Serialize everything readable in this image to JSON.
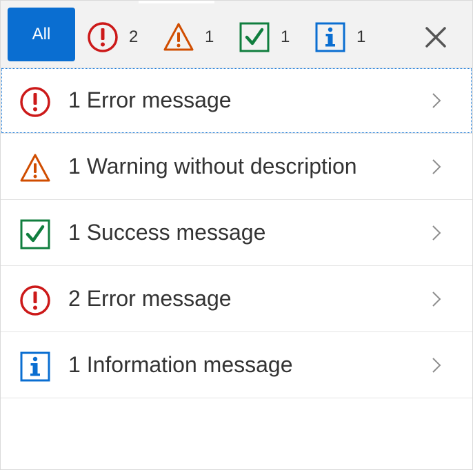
{
  "filter_bar": {
    "all_label": "All",
    "filters": [
      {
        "type": "error",
        "icon": "error-icon",
        "count": "2"
      },
      {
        "type": "warning",
        "icon": "warning-icon",
        "count": "1"
      },
      {
        "type": "success",
        "icon": "success-icon",
        "count": "1"
      },
      {
        "type": "information",
        "icon": "info-icon",
        "count": "1"
      }
    ],
    "close_icon": "close-icon"
  },
  "messages": [
    {
      "type": "error",
      "icon": "error-icon",
      "label": "1 Error message"
    },
    {
      "type": "warning",
      "icon": "warning-icon",
      "label": "1 Warning without description"
    },
    {
      "type": "success",
      "icon": "success-icon",
      "label": "1 Success message"
    },
    {
      "type": "error",
      "icon": "error-icon",
      "label": "2 Error message"
    },
    {
      "type": "information",
      "icon": "info-icon",
      "label": "1 Information message"
    }
  ],
  "colors": {
    "accent": "#0a6ed1",
    "error": "#cc1919",
    "warning": "#d04d00",
    "success": "#107e3e",
    "information": "#0a6ed1"
  }
}
